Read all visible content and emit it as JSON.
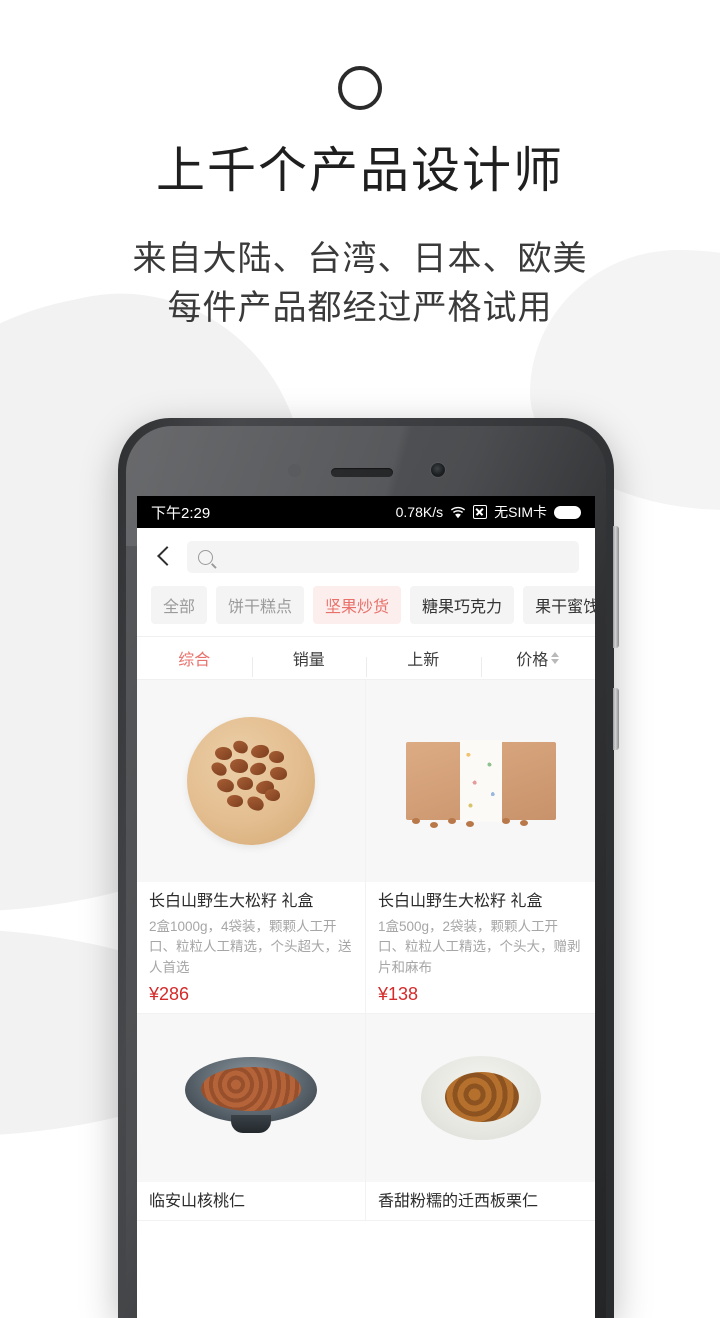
{
  "promo": {
    "logo_icon": "circle-outline-logo",
    "headline": "上千个产品设计师",
    "sub_line1": "来自大陆、台湾、日本、欧美",
    "sub_line2": "每件产品都经过严格试用"
  },
  "phone": {
    "sensor_icon": "proximity-sensor",
    "earpiece_icon": "earpiece-speaker",
    "camera_icon": "front-camera",
    "volume_button": "volume-rocker",
    "power_button": "power-button"
  },
  "status_bar": {
    "time": "下午2:29",
    "network_speed": "0.78K/s",
    "wifi_icon": "wifi-icon",
    "signal_off_icon": "signal-disabled-icon",
    "sim": "无SIM卡",
    "battery_icon": "battery-full-icon"
  },
  "nav": {
    "back_icon": "back-chevron-icon",
    "search_icon": "search-icon",
    "search_value": "",
    "search_placeholder": ""
  },
  "categories": [
    {
      "label": "全部",
      "state": "muted"
    },
    {
      "label": "饼干糕点",
      "state": "muted"
    },
    {
      "label": "坚果炒货",
      "state": "active"
    },
    {
      "label": "糖果巧克力",
      "state": "normal"
    },
    {
      "label": "果干蜜饯",
      "state": "normal"
    }
  ],
  "sort_tabs": [
    {
      "label": "综合",
      "active": true,
      "has_arrows": false
    },
    {
      "label": "销量",
      "active": false,
      "has_arrows": false
    },
    {
      "label": "上新",
      "active": false,
      "has_arrows": false
    },
    {
      "label": "价格",
      "active": false,
      "has_arrows": true
    }
  ],
  "products": [
    {
      "title": "长白山野生大松籽 礼盒",
      "desc": "2盒1000g，4袋装，颗颗人工开口、粒粒人工精选，个头超大，送人首选",
      "price": "¥286",
      "image_icon": "pine-nuts-on-wooden-plate"
    },
    {
      "title": "长白山野生大松籽 礼盒",
      "desc": "1盒500g，2袋装，颗颗人工开口、粒粒人工精选，个头大，赠剥片和麻布",
      "price": "¥138",
      "image_icon": "kraft-gift-box"
    },
    {
      "title": "临安山核桃仁",
      "desc": "",
      "price": "",
      "image_icon": "walnut-kernels-in-dark-bowl"
    },
    {
      "title": "香甜粉糯的迁西板栗仁",
      "desc": "",
      "price": "",
      "image_icon": "chestnuts-on-light-plate"
    }
  ],
  "colors": {
    "accent_red": "#e8716b",
    "price_red": "#d42a2a",
    "chip_bg": "#f4f4f4",
    "chip_active_bg": "#fdeeee",
    "page_bg": "#ffffff",
    "decor_gray": "#f2f2f2"
  }
}
